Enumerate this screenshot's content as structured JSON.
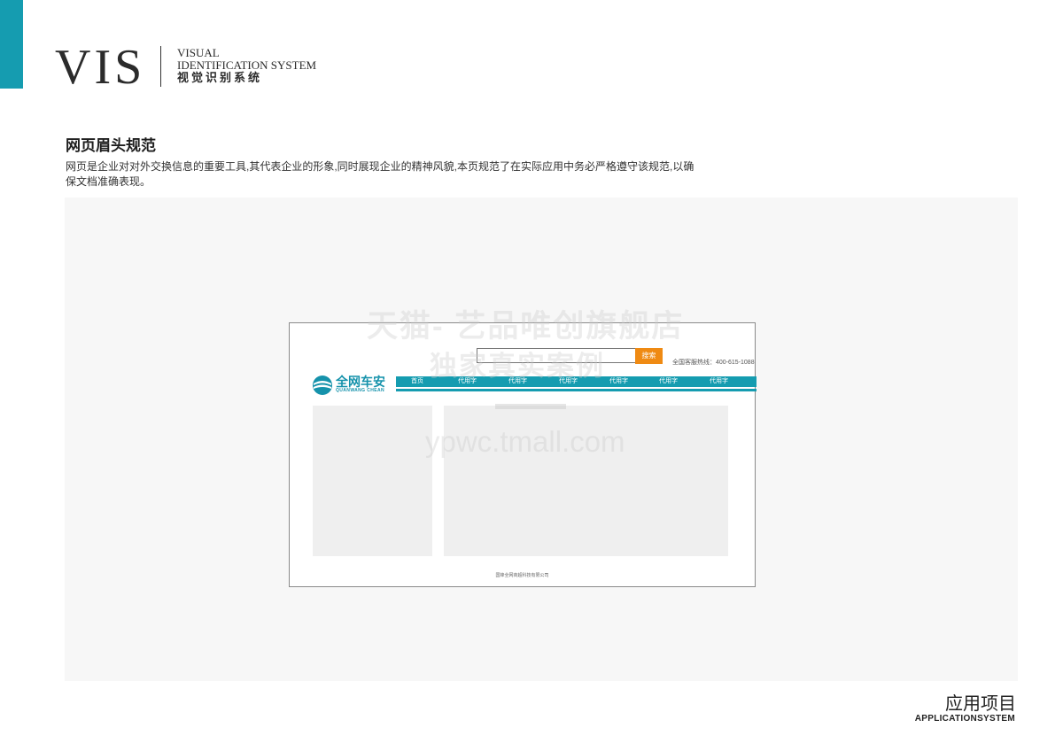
{
  "header": {
    "logo": "VIS",
    "subtitle_line1": "VISUAL",
    "subtitle_line2": "IDENTIFICATION SYSTEM",
    "subtitle_cn": "视觉识别系统"
  },
  "section": {
    "title": "网页眉头规范",
    "description": "网页是企业对对外交换信息的重要工具,其代表企业的形象,同时展现企业的精神风貌,本页规范了在实际应用中务必严格遵守该规范,以确保文档准确表现。"
  },
  "mockup": {
    "search_button": "搜索",
    "hotline": "全国客服热线：400-615-1088",
    "logo_name": "全网车安",
    "logo_en": "QUANWANG CHEAN",
    "nav_items": [
      "首页",
      "代用字",
      "代用字",
      "代用字",
      "代用字",
      "代用字",
      "代用字"
    ],
    "footer": "国锋全网商超科技有限公司"
  },
  "watermark": {
    "line1": "天猫- 艺品唯创旗舰店",
    "line2": "独家真实案例",
    "line3": "ypwc.tmall.com"
  },
  "footer": {
    "title_cn": "应用项目",
    "title_en": "APPLICATIONSYSTEM"
  },
  "colors": {
    "brand_teal": "#159cb0",
    "search_orange": "#ef8a13"
  }
}
